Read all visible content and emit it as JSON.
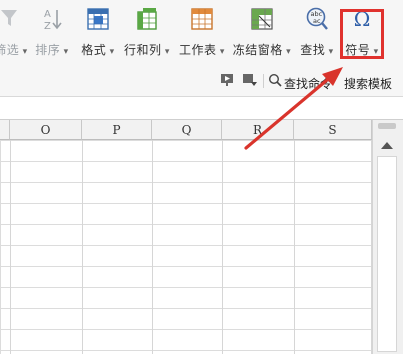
{
  "ribbon": {
    "tools": [
      {
        "label": "筛选",
        "icon": "filter-icon",
        "muted": true
      },
      {
        "label": "排序",
        "icon": "sort-az-icon",
        "muted": true
      },
      {
        "label": "格式",
        "icon": "format-cells-icon",
        "muted": false
      },
      {
        "label": "行和列",
        "icon": "rows-columns-icon",
        "muted": false
      },
      {
        "label": "工作表",
        "icon": "worksheet-icon",
        "muted": false
      },
      {
        "label": "冻结窗格",
        "icon": "freeze-panes-icon",
        "muted": false
      },
      {
        "label": "查找",
        "icon": "find-replace-icon",
        "muted": false
      },
      {
        "label": "符号",
        "icon": "omega-symbol-icon",
        "muted": false
      }
    ],
    "row2": {
      "find_command": "查找命令",
      "search_template": "搜索模板"
    }
  },
  "grid": {
    "columns": [
      "O",
      "P",
      "Q",
      "R",
      "S"
    ]
  },
  "colors": {
    "highlight": "#e0322e",
    "arrow": "#d9342c"
  }
}
